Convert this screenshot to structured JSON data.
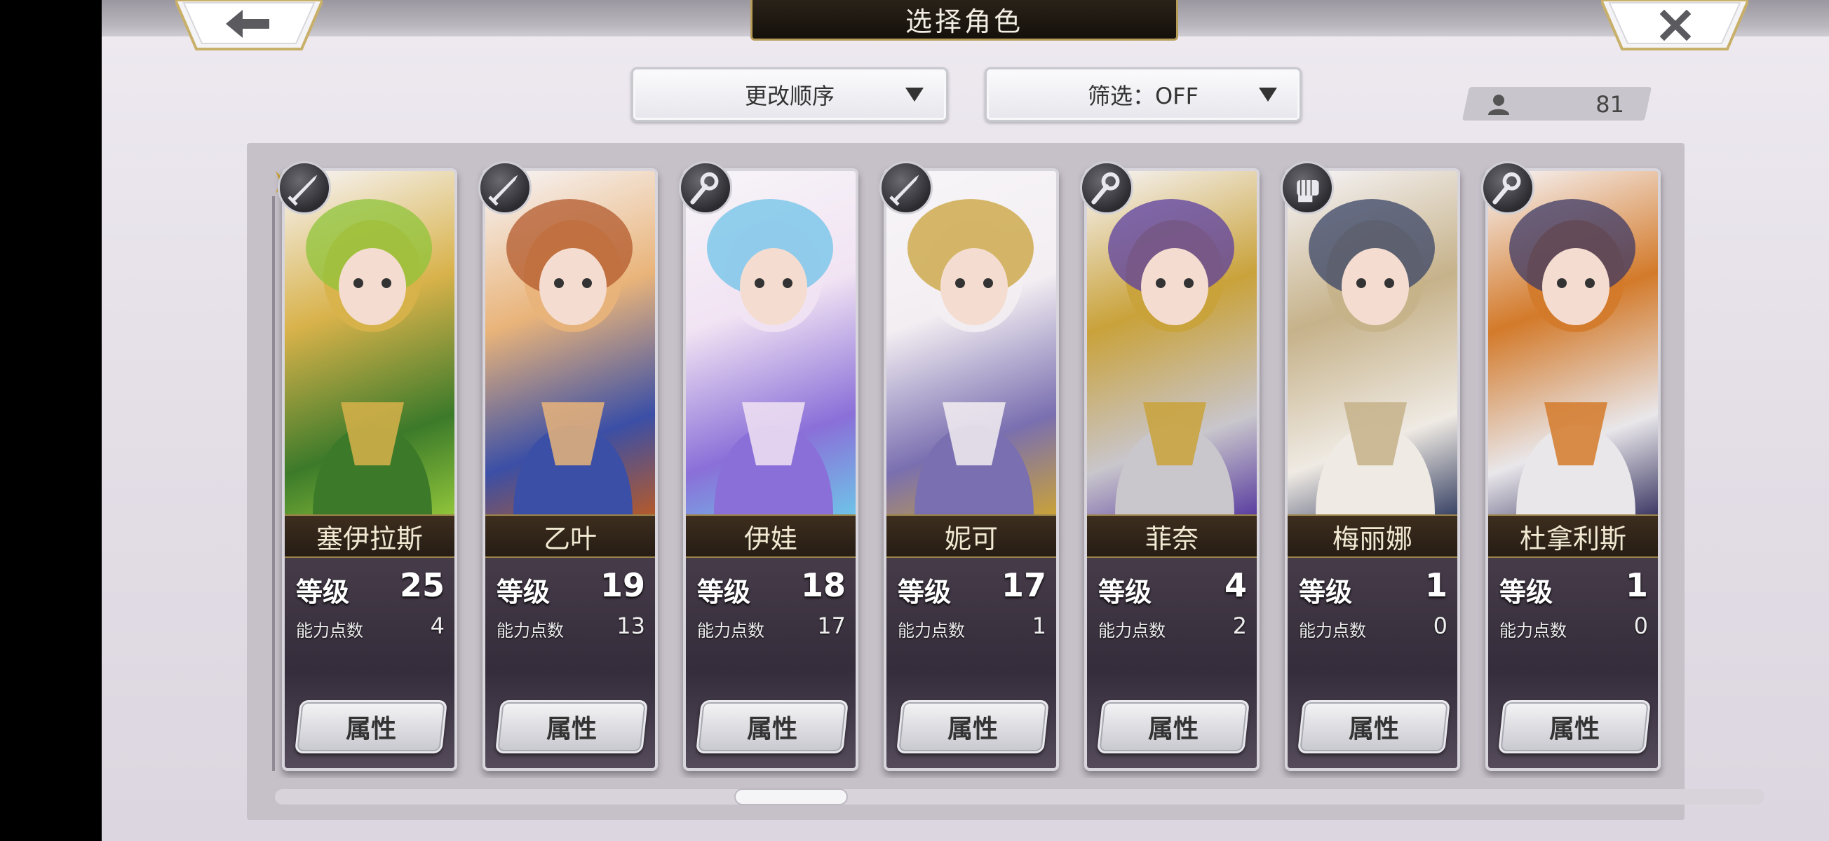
{
  "header": {
    "title": "选择角色",
    "back_icon": "arrow-left-icon",
    "close_icon": "close-icon"
  },
  "controls": {
    "sort_label": "更改顺序",
    "filter_label": "筛选：OFF",
    "character_count": "81"
  },
  "labels": {
    "level": "等级",
    "ability_points": "能力点数",
    "attribute_button": "属性"
  },
  "characters": [
    {
      "name": "塞伊拉斯",
      "level": "25",
      "points": "4",
      "weapon": "sword-icon",
      "palette": [
        "#3c7a2a",
        "#8fc43a",
        "#d8b24a"
      ]
    },
    {
      "name": "乙叶",
      "level": "19",
      "points": "13",
      "weapon": "sword-icon",
      "palette": [
        "#3b4fa6",
        "#b35a2c",
        "#e9b47a"
      ]
    },
    {
      "name": "伊娃",
      "level": "18",
      "points": "17",
      "weapon": "staff-icon",
      "palette": [
        "#8a6fd8",
        "#6fc3e8",
        "#f1e3f3"
      ]
    },
    {
      "name": "妮可",
      "level": "17",
      "points": "1",
      "weapon": "sword-icon",
      "palette": [
        "#7a6fb0",
        "#c9a23a",
        "#f3eef2"
      ]
    },
    {
      "name": "菲奈",
      "level": "4",
      "points": "2",
      "weapon": "staff-icon",
      "palette": [
        "#c9c6cc",
        "#5b3fa0",
        "#c9a23a"
      ]
    },
    {
      "name": "梅丽娜",
      "level": "1",
      "points": "0",
      "weapon": "fist-icon",
      "palette": [
        "#efeae3",
        "#3a4466",
        "#c6b28a"
      ]
    },
    {
      "name": "杜拿利斯",
      "level": "1",
      "points": "0",
      "weapon": "staff-icon",
      "palette": [
        "#e9e7ea",
        "#3e3a66",
        "#d37a2a"
      ]
    }
  ]
}
